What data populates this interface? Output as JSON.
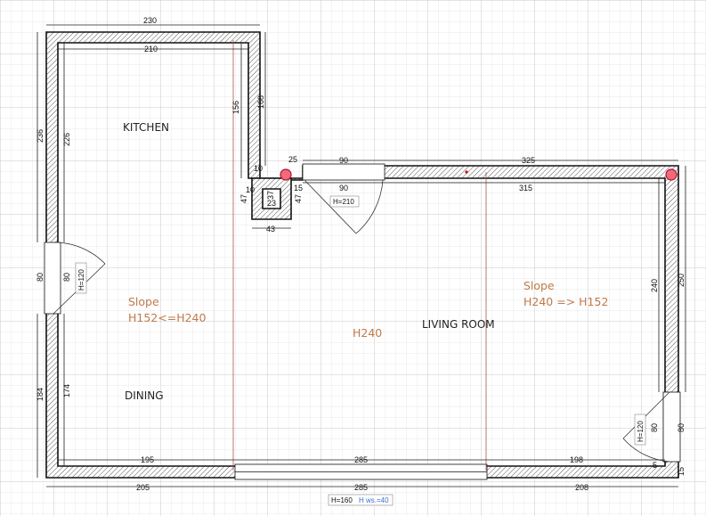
{
  "rooms": {
    "kitchen": "KITCHEN",
    "dining": "DINING",
    "living": "LIVING ROOM"
  },
  "annotations": {
    "slope_left_title": "Slope",
    "slope_left_value": "H152<=H240",
    "slope_right_title": "Slope",
    "slope_right_value": "H240 => H152",
    "center_height": "H240"
  },
  "tags": {
    "door_top": "H=210",
    "door_left": "H=120",
    "door_right": "H=120",
    "window_bottom_h": "H=160",
    "window_bottom_ws": "H ws.=40"
  },
  "dims": {
    "kitchen_outer_top": "230",
    "kitchen_inner_top": "210",
    "kitchen_left_outer": "236",
    "kitchen_left_inner": "226",
    "kitchen_right_156": "156",
    "kitchen_right_168": "168",
    "notch_10a": "10",
    "notch_10b": "10",
    "notch_47a": "47",
    "notch_47b": "47",
    "notch_23": "23",
    "notch_37": "37",
    "notch_43": "43",
    "top_25": "25",
    "top_15": "15",
    "top_90a": "90",
    "top_90b": "90",
    "top_325": "325",
    "top_315": "315",
    "right_240": "240",
    "right_250": "250",
    "right_80a": "80",
    "right_80b": "80",
    "right_5": "5",
    "right_15": "15",
    "left_80a": "80",
    "left_80b": "80",
    "left_184": "184",
    "left_174": "174",
    "bottom_195": "195",
    "bottom_285a": "285",
    "bottom_198": "198",
    "bottom_205": "205",
    "bottom_285b": "285",
    "bottom_208": "208"
  },
  "colors": {
    "wall": "#111111",
    "grid_minor": "#e3e3e3",
    "grid_major": "#c8c8c8",
    "slope_text": "#c07a4a",
    "guide_line": "#a04030",
    "marker": "#e04050"
  }
}
